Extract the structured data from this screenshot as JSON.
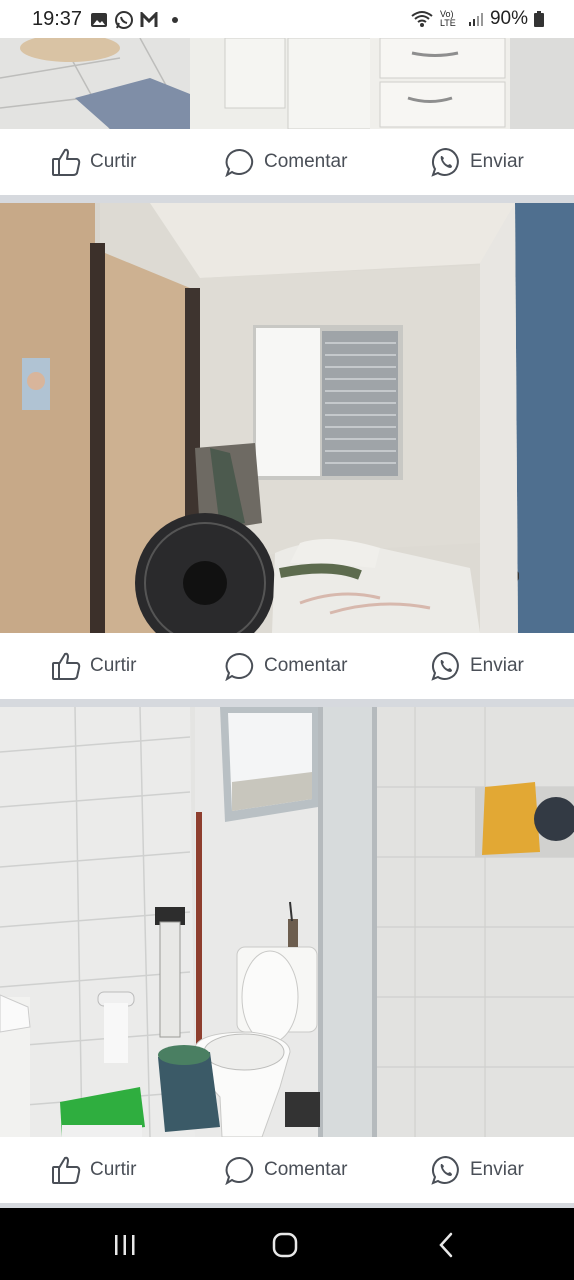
{
  "status_bar": {
    "time": "19:37",
    "notification_icons": [
      "image-icon",
      "whatsapp-icon",
      "gmail-icon"
    ],
    "network_label": "Vo) LTE",
    "battery": "90%"
  },
  "posts": [
    {
      "image": "Kitchen cabinets and floor",
      "actions": {
        "like": "Curtir",
        "comment": "Comentar",
        "share": "Enviar"
      }
    },
    {
      "image": "Bedroom with bed, fan and window",
      "actions": {
        "like": "Curtir",
        "comment": "Comentar",
        "share": "Enviar"
      }
    },
    {
      "image": "Bathroom with toilet and shower stall",
      "actions": {
        "like": "Curtir",
        "comment": "Comentar",
        "share": "Enviar"
      }
    }
  ],
  "nav_bar": {
    "buttons": [
      "recent-apps-icon",
      "home-icon",
      "back-icon"
    ]
  },
  "colors": {
    "action_text": "#4a4f57",
    "separator": "#d6d9de",
    "nav_bar": "#000000"
  }
}
